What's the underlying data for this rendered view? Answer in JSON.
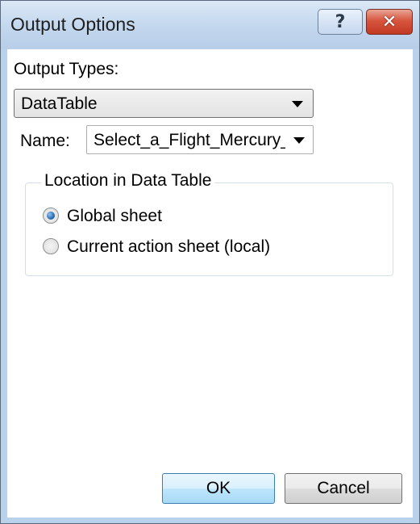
{
  "window": {
    "title": "Output Options",
    "help_glyph": "?",
    "close_glyph": "✕"
  },
  "output_types": {
    "label": "Output Types:",
    "selected": "DataTable"
  },
  "name": {
    "label": "Name:",
    "selected": "Select_a_Flight_Mercury_"
  },
  "location": {
    "legend": "Location in Data Table",
    "options": [
      {
        "label": "Global sheet",
        "checked": true
      },
      {
        "label": "Current action sheet (local)",
        "checked": false
      }
    ]
  },
  "buttons": {
    "ok": "OK",
    "cancel": "Cancel"
  }
}
